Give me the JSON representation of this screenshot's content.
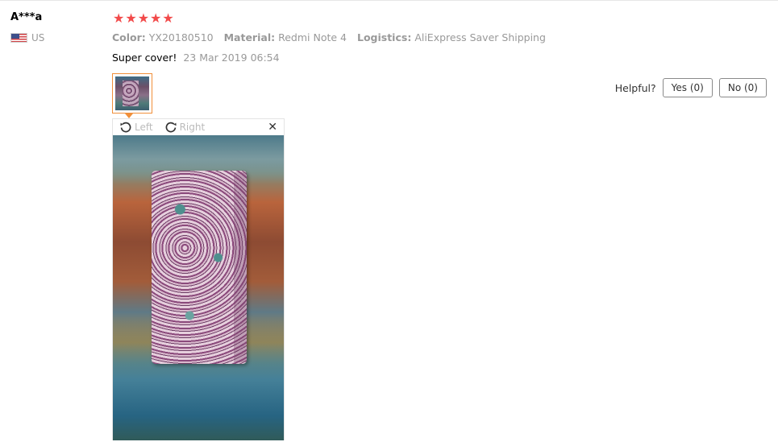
{
  "reviewer": {
    "name": "A***a",
    "country": "US"
  },
  "rating": {
    "stars": 5,
    "max": 5,
    "color": "#f24a4a"
  },
  "attributes": [
    {
      "key": "Color:",
      "value": "YX20180510"
    },
    {
      "key": "Material:",
      "value": "Redmi Note 4"
    },
    {
      "key": "Logistics:",
      "value": "AliExpress Saver Shipping"
    }
  ],
  "review": {
    "text": "Super cover!",
    "date": "23 Mar 2019 06:54"
  },
  "viewer": {
    "rotate_left": "Left",
    "rotate_right": "Right"
  },
  "helpful": {
    "label": "Helpful?",
    "yes": "Yes (0)",
    "no": "No (0)"
  },
  "colors": {
    "accent": "#f08f3a",
    "muted": "#999999"
  }
}
